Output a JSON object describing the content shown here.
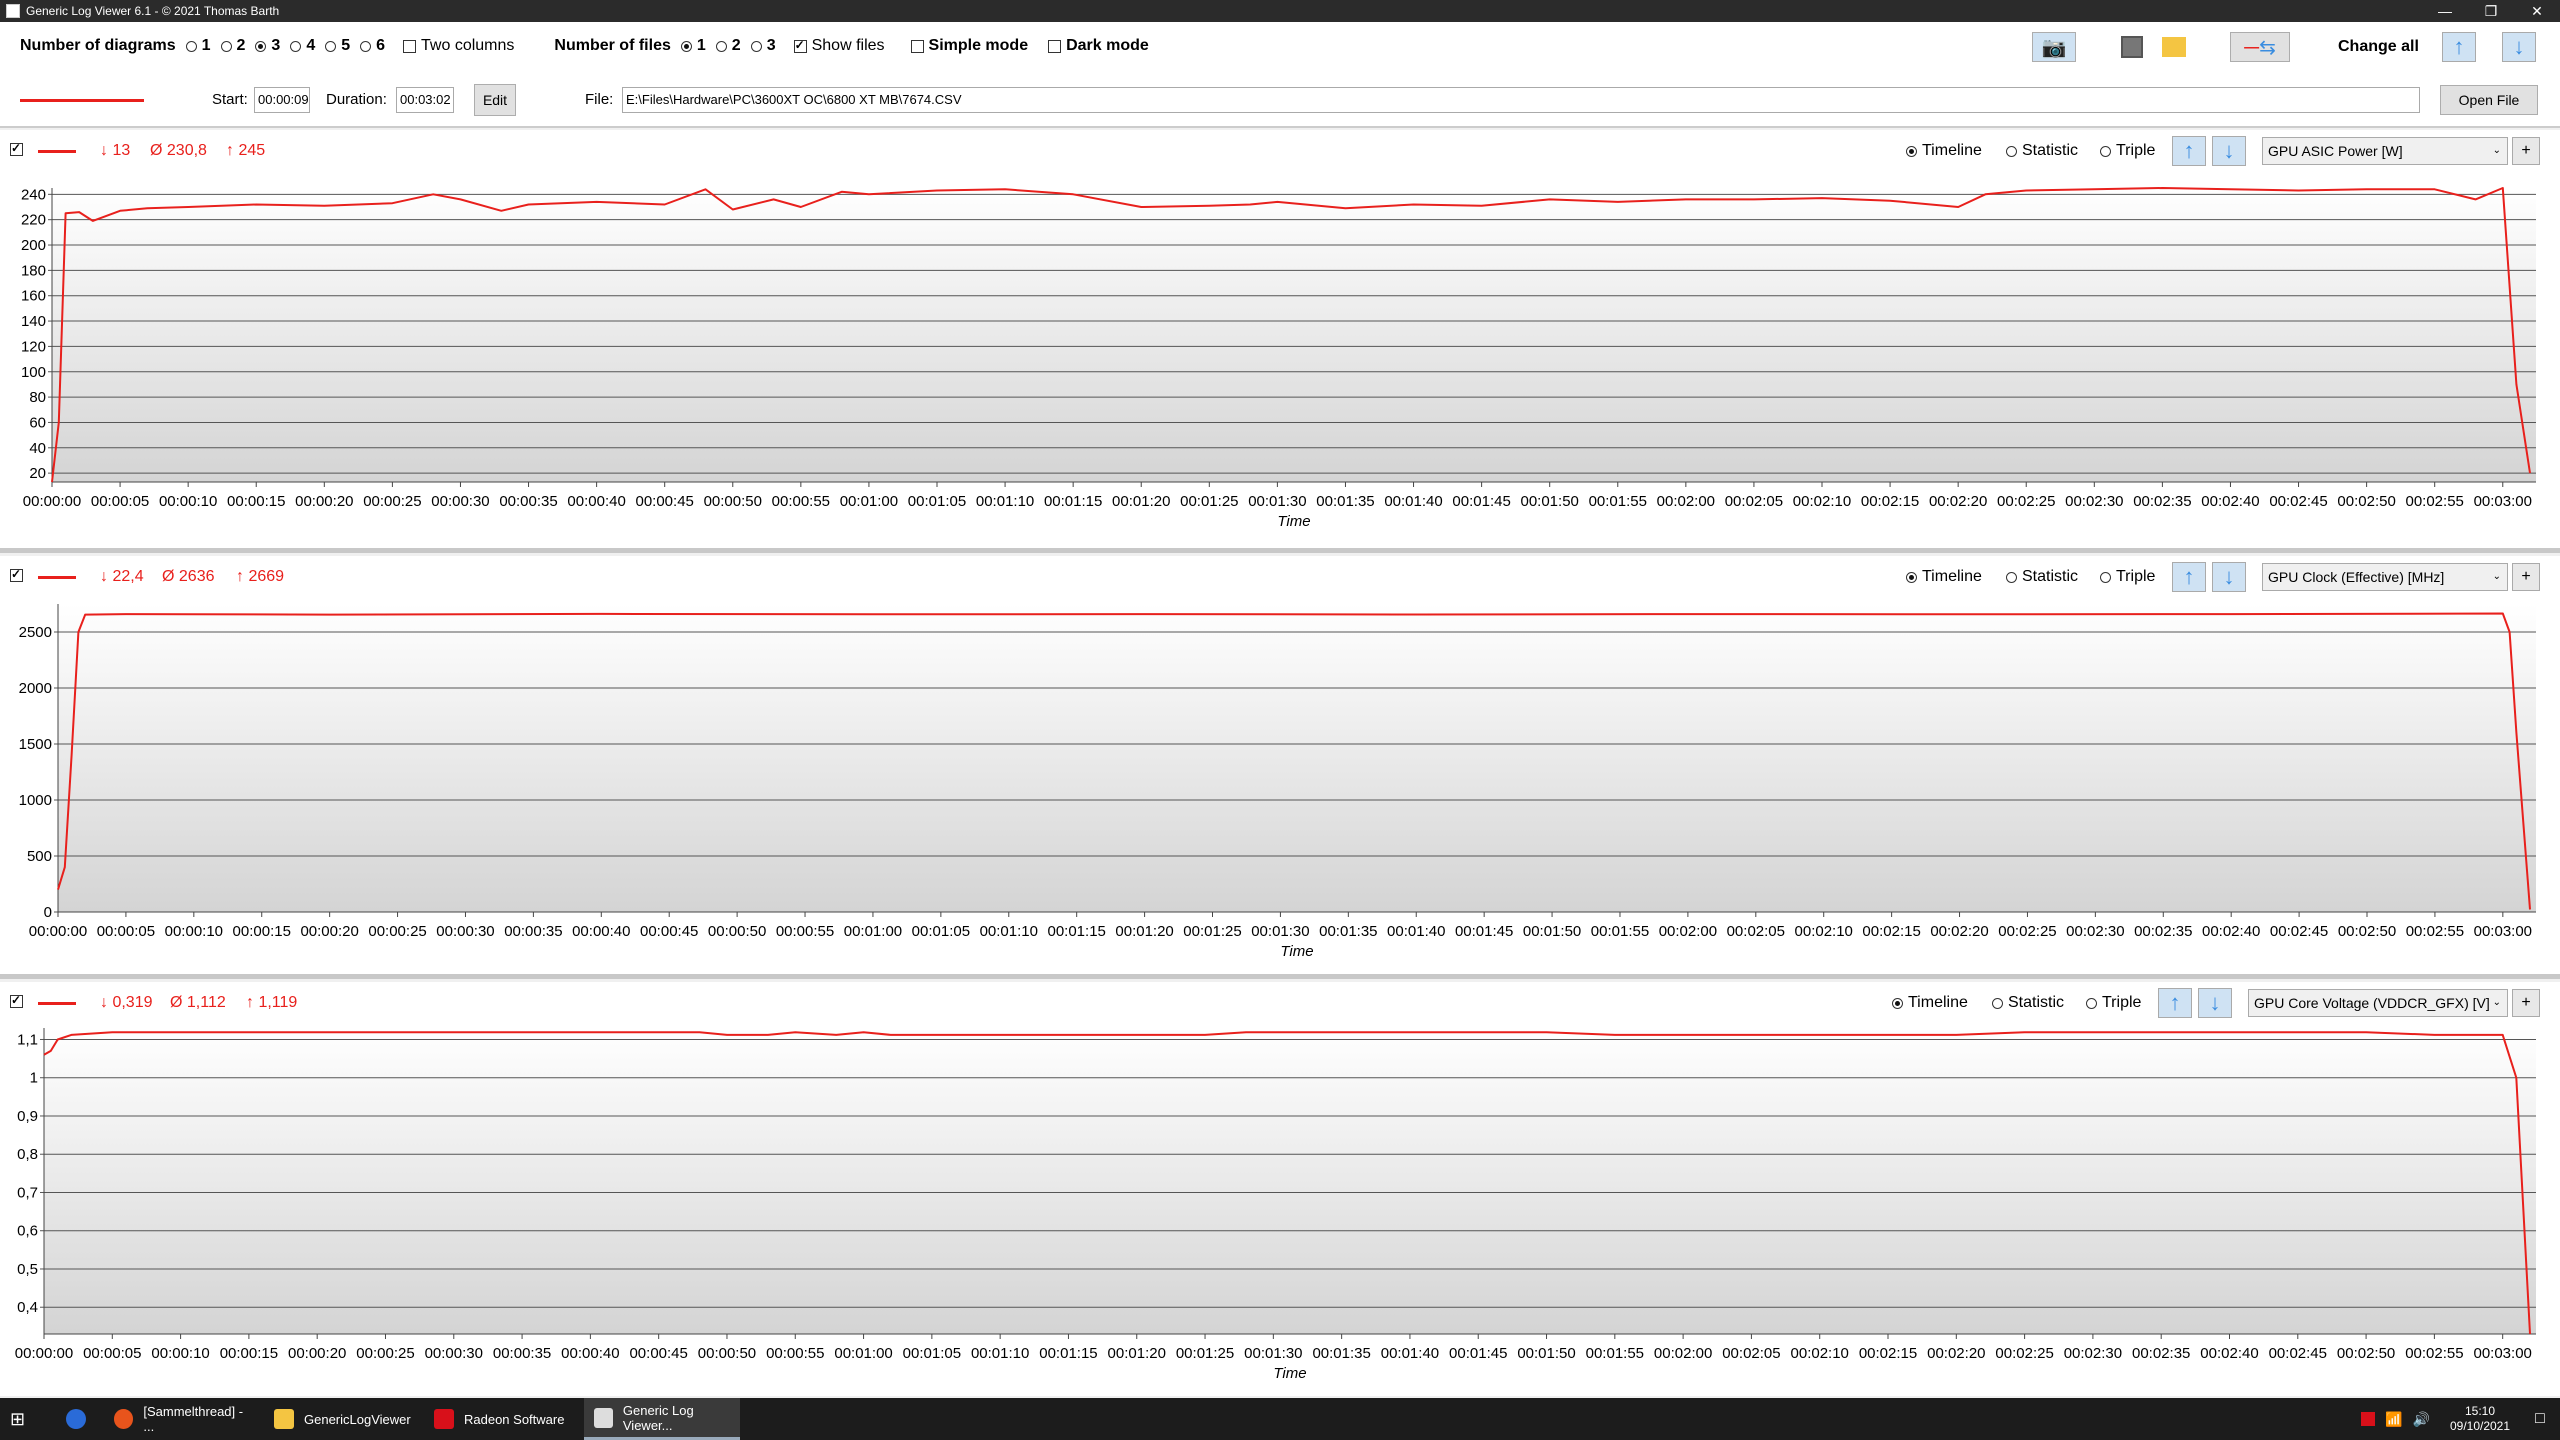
{
  "window": {
    "title": "Generic Log Viewer 6.1 - © 2021 Thomas Barth"
  },
  "toolbar": {
    "num_diagrams_label": "Number of diagrams",
    "diagram_options": [
      "1",
      "2",
      "3",
      "4",
      "5",
      "6"
    ],
    "diagram_selected": "3",
    "two_columns_label": "Two columns",
    "num_files_label": "Number of files",
    "file_options": [
      "1",
      "2",
      "3"
    ],
    "file_selected": "1",
    "show_files_label": "Show files",
    "simple_mode_label": "Simple mode",
    "dark_mode_label": "Dark mode",
    "change_all_label": "Change all"
  },
  "filebar": {
    "start_label": "Start:",
    "start_value": "00:00:09",
    "duration_label": "Duration:",
    "duration_value": "00:03:02",
    "edit_label": "Edit",
    "file_label": "File:",
    "file_path": "E:\\Files\\Hardware\\PC\\3600XT OC\\6800 XT MB\\7674.CSV",
    "open_file_label": "Open File",
    "series_color": "#e8201c"
  },
  "view_options": {
    "timeline": "Timeline",
    "statistic": "Statistic",
    "triple": "Triple"
  },
  "panels": [
    {
      "sensor": "GPU ASIC Power [W]",
      "min": "↓ 13",
      "avg": "Ø 230,8",
      "max": "↑ 245",
      "chart_data": {
        "type": "line",
        "xlabel": "Time",
        "ylabel": "",
        "yticks": [
          "240",
          "220",
          "200",
          "180",
          "160",
          "140",
          "120",
          "100",
          "80",
          "60",
          "40",
          "20"
        ],
        "ylim": [
          13,
          245
        ],
        "xrange_seconds": [
          0,
          182
        ],
        "x": [
          0,
          0.5,
          1,
          2,
          3,
          5,
          7,
          10,
          15,
          20,
          25,
          28,
          30,
          33,
          35,
          40,
          45,
          48,
          50,
          53,
          55,
          58,
          60,
          65,
          70,
          75,
          80,
          85,
          88,
          90,
          95,
          100,
          105,
          110,
          115,
          120,
          125,
          130,
          135,
          140,
          142,
          145,
          150,
          155,
          160,
          165,
          170,
          175,
          178,
          180,
          181,
          182
        ],
        "y": [
          13,
          60,
          225,
          226,
          219,
          227,
          229,
          230,
          232,
          231,
          233,
          240,
          236,
          227,
          232,
          234,
          232,
          244,
          228,
          236,
          230,
          242,
          240,
          243,
          244,
          240,
          230,
          231,
          232,
          234,
          229,
          232,
          231,
          236,
          234,
          236,
          236,
          237,
          235,
          230,
          240,
          243,
          244,
          245,
          244,
          243,
          244,
          244,
          236,
          245,
          90,
          20
        ]
      }
    },
    {
      "sensor": "GPU Clock (Effective) [MHz]",
      "min": "↓ 22,4",
      "avg": "Ø 2636",
      "max": "↑ 2669",
      "chart_data": {
        "type": "line",
        "xlabel": "Time",
        "ylabel": "",
        "yticks": [
          "2500",
          "2000",
          "1500",
          "1000",
          "500",
          "0"
        ],
        "ylim": [
          0,
          2750
        ],
        "xrange_seconds": [
          0,
          182
        ],
        "x": [
          0,
          0.5,
          1,
          1.5,
          2,
          5,
          20,
          40,
          60,
          80,
          100,
          120,
          140,
          160,
          180,
          180.5,
          181,
          182
        ],
        "y": [
          200,
          400,
          1400,
          2500,
          2655,
          2660,
          2655,
          2662,
          2658,
          2660,
          2656,
          2660,
          2658,
          2660,
          2665,
          2500,
          1600,
          22
        ]
      }
    },
    {
      "sensor": "GPU Core Voltage (VDDCR_GFX) [V]",
      "min": "↓ 0,319",
      "avg": "Ø 1,112",
      "max": "↑ 1,119",
      "chart_data": {
        "type": "line",
        "xlabel": "Time",
        "ylabel": "",
        "yticks": [
          "1,1",
          "1",
          "0,9",
          "0,8",
          "0,7",
          "0,6",
          "0,5",
          "0,4"
        ],
        "ylim": [
          0.33,
          1.13
        ],
        "xrange_seconds": [
          0,
          182
        ],
        "x": [
          0,
          0.5,
          1,
          2,
          5,
          48,
          50,
          53,
          55,
          58,
          60,
          62,
          65,
          70,
          85,
          88,
          110,
          115,
          140,
          145,
          170,
          175,
          180,
          181,
          182
        ],
        "y": [
          1.06,
          1.07,
          1.1,
          1.112,
          1.119,
          1.119,
          1.112,
          1.112,
          1.119,
          1.112,
          1.119,
          1.112,
          1.112,
          1.112,
          1.112,
          1.119,
          1.119,
          1.112,
          1.112,
          1.119,
          1.119,
          1.112,
          1.112,
          1.0,
          0.33
        ]
      }
    }
  ],
  "x_ticks": [
    "00:00:00",
    "00:00:05",
    "00:00:10",
    "00:00:15",
    "00:00:20",
    "00:00:25",
    "00:00:30",
    "00:00:35",
    "00:00:40",
    "00:00:45",
    "00:00:50",
    "00:00:55",
    "00:01:00",
    "00:01:05",
    "00:01:10",
    "00:01:15",
    "00:01:20",
    "00:01:25",
    "00:01:30",
    "00:01:35",
    "00:01:40",
    "00:01:45",
    "00:01:50",
    "00:01:55",
    "00:02:00",
    "00:02:05",
    "00:02:10",
    "00:02:15",
    "00:02:20",
    "00:02:25",
    "00:02:30",
    "00:02:35",
    "00:02:40",
    "00:02:45",
    "00:02:50",
    "00:02:55",
    "00:03:00"
  ],
  "taskbar": {
    "tasks": [
      "[Sammelthread] - ...",
      "GenericLogViewer",
      "Radeon Software",
      "Generic Log Viewer..."
    ],
    "time": "15:10",
    "date": "09/10/2021"
  }
}
